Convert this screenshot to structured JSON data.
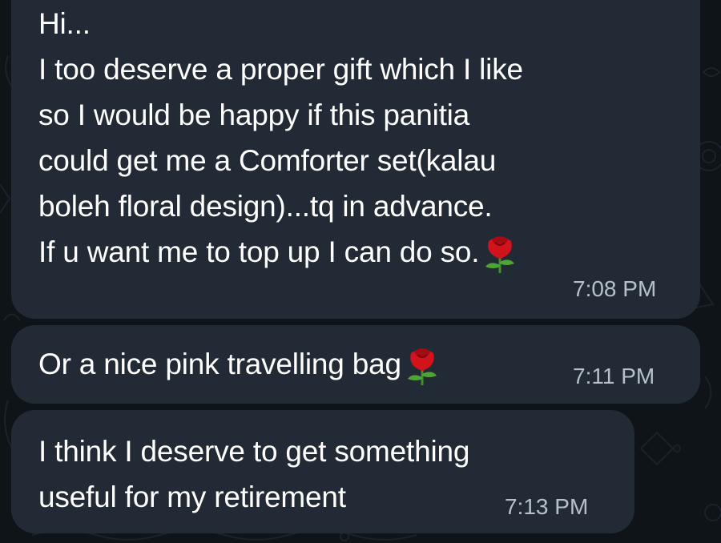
{
  "chat": {
    "messages": [
      {
        "lines": [
          "Hi...",
          "I too deserve a proper gift which I like",
          "so I would be happy if this panitia",
          "could get me a Comforter set(kalau",
          "boleh floral design)...tq in advance.",
          "If u want me to top up I can do so."
        ],
        "emoji": "rose-emoji",
        "time": "7:08 PM"
      },
      {
        "lines": [
          "Or a nice pink travelling bag"
        ],
        "emoji": "rose-emoji",
        "time": "7:11 PM"
      },
      {
        "lines": [
          "I think I deserve to get something",
          "useful for my retirement"
        ],
        "time": "7:13 PM"
      }
    ]
  },
  "colors": {
    "background": "#0f1419",
    "bubble": "#222b35",
    "message_text": "#ffffff",
    "timestamp": "#b7c0c8"
  }
}
